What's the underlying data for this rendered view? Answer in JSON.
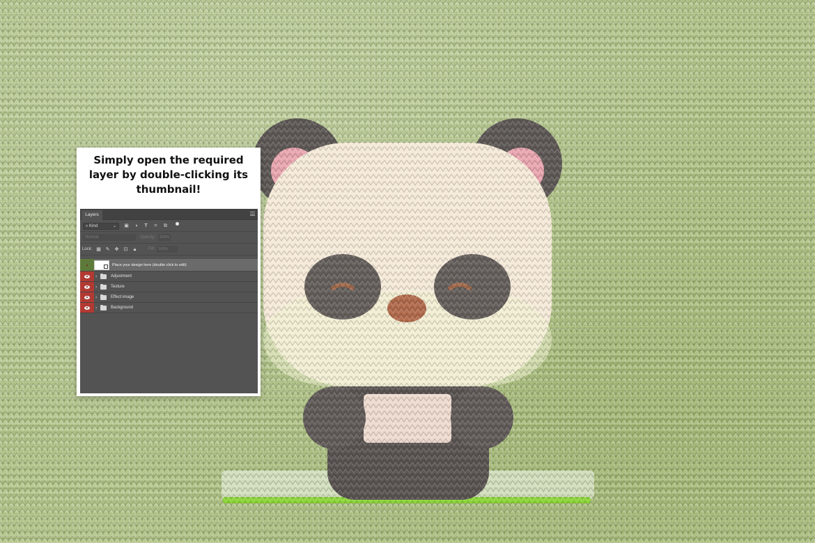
{
  "card": {
    "title": "Simply open the required layer by double-clicking its thumbnail!"
  },
  "layers_panel": {
    "tab_label": "Layers",
    "filter_kind": "Kind",
    "filter_icons": [
      "image-filter-icon",
      "adjustment-filter-icon",
      "type-filter-icon",
      "shape-filter-icon",
      "smart-object-filter-icon"
    ],
    "blend_mode": "Normal",
    "opacity_label": "Opacity:",
    "opacity_value": "100%",
    "lock_label": "Lock:",
    "lock_icons": [
      "lock-transparent-icon",
      "lock-paint-icon",
      "lock-move-icon",
      "lock-artboard-icon",
      "lock-all-icon"
    ],
    "fill_label": "Fill:",
    "fill_value": "100%",
    "layers": [
      {
        "name": "Place your design here (double click to edit)",
        "type": "smart-object",
        "visible": true,
        "selected": true
      },
      {
        "name": "Adjustment",
        "type": "group",
        "visible": true
      },
      {
        "name": "Texture",
        "type": "group",
        "visible": true
      },
      {
        "name": "Effect image",
        "type": "group",
        "visible": true
      },
      {
        "name": "Background",
        "type": "group",
        "visible": true
      }
    ]
  },
  "colors": {
    "background_knit": "#b3c58a",
    "visibility_red": "#b23a33",
    "visibility_green": "#5e7a3a",
    "panel_gray": "#535353"
  }
}
